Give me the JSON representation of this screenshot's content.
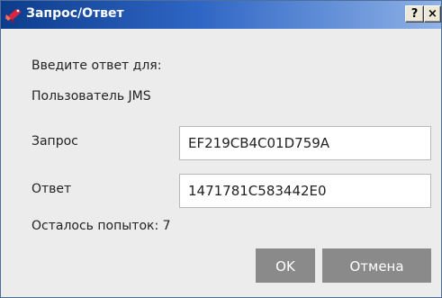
{
  "window": {
    "title": "Запрос/Ответ",
    "title_icon": "key-ribbon-icon",
    "help_button": "?",
    "close_button": "×"
  },
  "form": {
    "prompt": "Введите ответ для:",
    "username": "Пользователь JMS",
    "request_label": "Запрос",
    "request_value": "EF219CB4C01D759A",
    "answer_label": "Ответ",
    "answer_value": "1471781C583442E0",
    "attempts_text": "Осталось попыток: 7"
  },
  "buttons": {
    "ok": "OK",
    "cancel": "Отмена"
  },
  "colors": {
    "titlebar_start": "#0d3c8c",
    "titlebar_end": "#8fb2e6",
    "dialog_background": "#ececec",
    "button_background": "#8a8a8a",
    "icon_accent": "#d7263d"
  }
}
